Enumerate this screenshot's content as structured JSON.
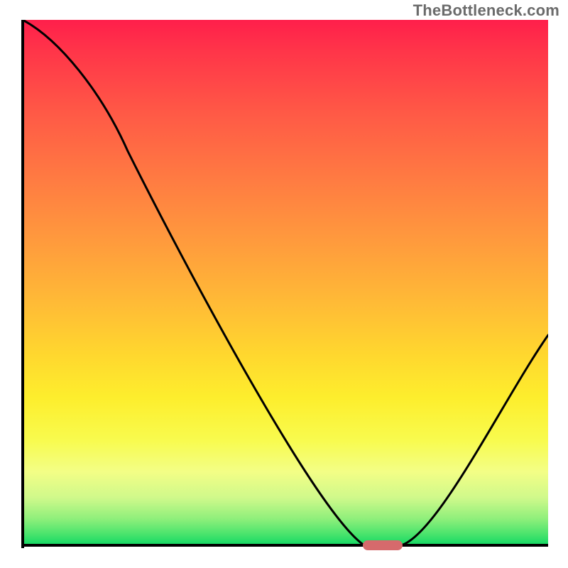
{
  "watermark": "TheBottleneck.com",
  "chart_data": {
    "type": "line",
    "title": "",
    "xlabel": "",
    "ylabel": "",
    "xlim": [
      0,
      100
    ],
    "ylim": [
      0,
      100
    ],
    "x": [
      0,
      20,
      65,
      72,
      100
    ],
    "values": [
      100,
      75,
      0,
      0,
      40
    ],
    "annotations": [
      {
        "kind": "marker",
        "x_range": [
          65,
          72
        ],
        "y": 0,
        "color": "#d66a6c"
      }
    ],
    "background_gradient": {
      "direction": "top-to-bottom",
      "stops": [
        {
          "pos": 0,
          "color": "#ff1f4b"
        },
        {
          "pos": 18,
          "color": "#ff5a46"
        },
        {
          "pos": 42,
          "color": "#ff9a3d"
        },
        {
          "pos": 64,
          "color": "#ffd82e"
        },
        {
          "pos": 80,
          "color": "#f8fb4e"
        },
        {
          "pos": 95,
          "color": "#8eef7b"
        },
        {
          "pos": 100,
          "color": "#12d864"
        }
      ]
    }
  },
  "marker_color": "#d66a6c"
}
